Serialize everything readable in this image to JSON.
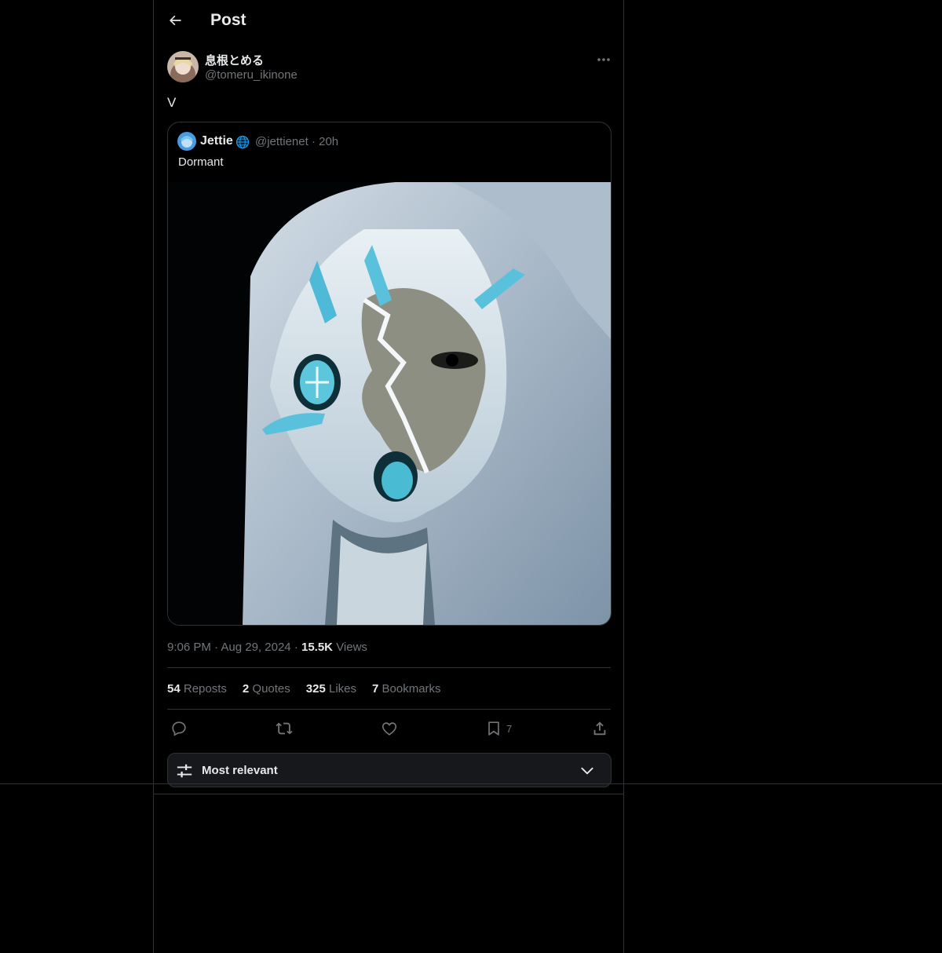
{
  "header": {
    "title": "Post"
  },
  "post": {
    "author_name": "息根とめる",
    "author_handle": "@tomeru_ikinone",
    "text": "V",
    "time": "9:06 PM",
    "date": "Aug 29, 2024",
    "views_count": "15.5K",
    "views_label": "Views"
  },
  "quote": {
    "author_name": "Jettie",
    "author_handle": "@jettienet",
    "age": "20h",
    "text": "Dormant"
  },
  "stats": {
    "reposts_count": "54",
    "reposts_label": "Reposts",
    "quotes_count": "2",
    "quotes_label": "Quotes",
    "likes_count": "325",
    "likes_label": "Likes",
    "bookmarks_count": "7",
    "bookmarks_label": "Bookmarks"
  },
  "actions": {
    "bookmark_count": "7"
  },
  "sort": {
    "label": "Most relevant"
  },
  "icons": [
    "back-arrow-icon",
    "more-icon",
    "globe-icon",
    "reply-icon",
    "repost-icon",
    "like-icon",
    "bookmark-icon",
    "share-icon",
    "sliders-icon",
    "chevron-down-icon"
  ],
  "colors": {
    "background": "#000000",
    "text": "#e7e9ea",
    "muted": "#71767b",
    "border": "#2f3336",
    "sort_bg": "#16181c"
  }
}
